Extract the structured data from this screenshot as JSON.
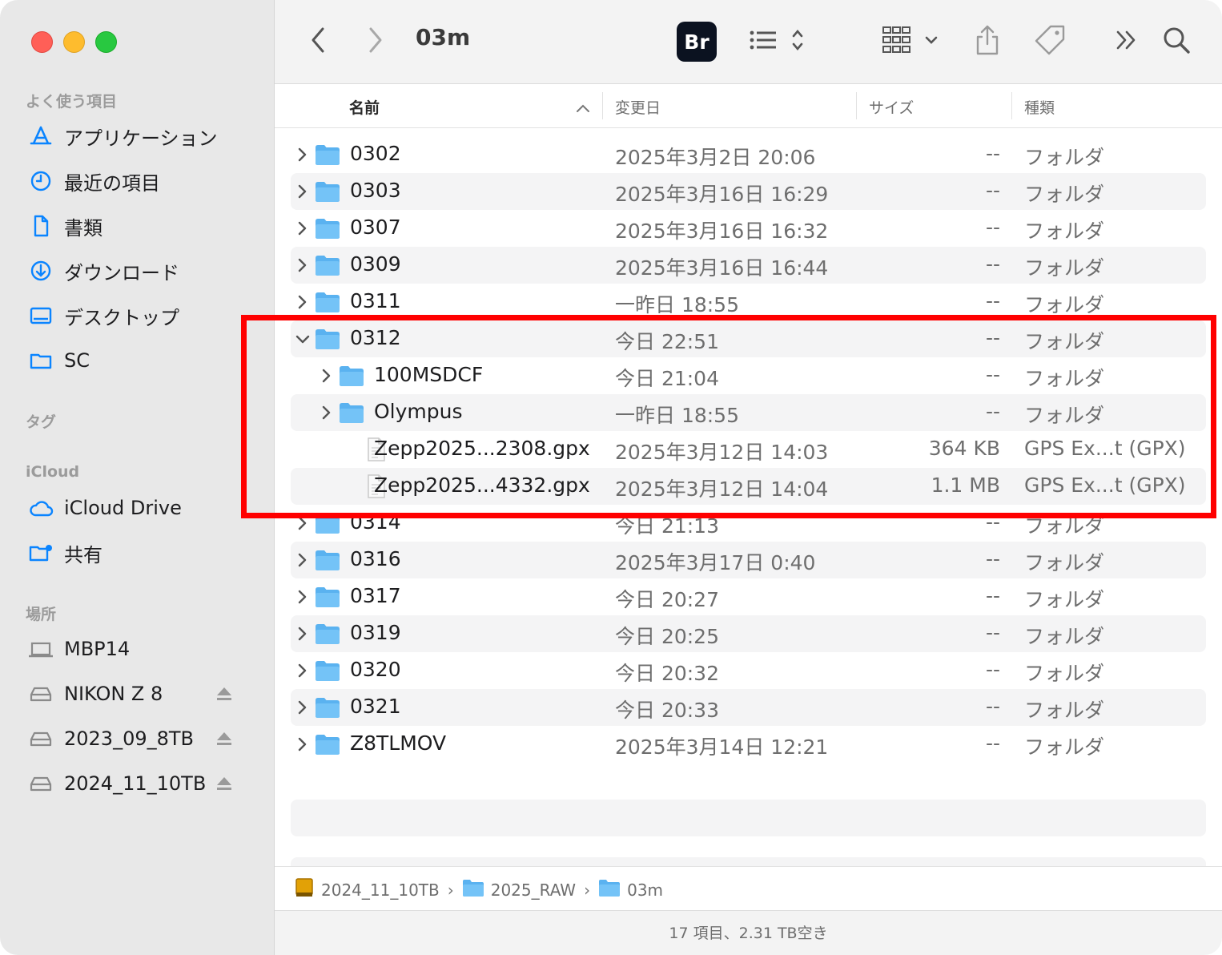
{
  "window": {
    "title": "03m"
  },
  "colors": {
    "accent": "#0a84ff",
    "folder": "#5ab2f0",
    "highlight": "#ff0000"
  },
  "sidebar": {
    "favorites_title": "よく使う項目",
    "favorites": [
      {
        "label": "アプリケーション",
        "icon": "applications-icon"
      },
      {
        "label": "最近の項目",
        "icon": "recents-icon"
      },
      {
        "label": "書類",
        "icon": "document-icon"
      },
      {
        "label": "ダウンロード",
        "icon": "download-icon"
      },
      {
        "label": "デスクトップ",
        "icon": "desktop-icon"
      },
      {
        "label": "SC",
        "icon": "folder-icon"
      }
    ],
    "tags_title": "タグ",
    "icloud_title": "iCloud",
    "icloud": [
      {
        "label": "iCloud Drive",
        "icon": "cloud-icon"
      },
      {
        "label": "共有",
        "icon": "shared-folder-icon"
      }
    ],
    "locations_title": "場所",
    "locations": [
      {
        "label": "MBP14",
        "icon": "laptop-icon"
      },
      {
        "label": "NIKON Z 8",
        "icon": "drive-icon"
      },
      {
        "label": "2023_09_8TB",
        "icon": "drive-icon"
      },
      {
        "label": "2024_11_10TB",
        "icon": "drive-icon"
      }
    ]
  },
  "toolbar": {
    "bridge_label": "Br"
  },
  "columns": {
    "name": "名前",
    "date": "変更日",
    "size": "サイズ",
    "kind": "種類"
  },
  "rows": [
    {
      "name": "0302",
      "date": "2025年3月2日 20:06",
      "size": "--",
      "kind": "フォルダ"
    },
    {
      "name": "0303",
      "date": "2025年3月16日 16:29",
      "size": "--",
      "kind": "フォルダ"
    },
    {
      "name": "0307",
      "date": "2025年3月16日 16:32",
      "size": "--",
      "kind": "フォルダ"
    },
    {
      "name": "0309",
      "date": "2025年3月16日 16:44",
      "size": "--",
      "kind": "フォルダ"
    },
    {
      "name": "0311",
      "date": "一昨日 18:55",
      "size": "--",
      "kind": "フォルダ"
    },
    {
      "name": "0312",
      "date": "今日 22:51",
      "size": "--",
      "kind": "フォルダ"
    },
    {
      "name": "100MSDCF",
      "date": "今日 21:04",
      "size": "--",
      "kind": "フォルダ"
    },
    {
      "name": "Olympus",
      "date": "一昨日 18:55",
      "size": "--",
      "kind": "フォルダ"
    },
    {
      "name": "Zepp2025...2308.gpx",
      "date": "2025年3月12日 14:03",
      "size": "364 KB",
      "kind": "GPS Ex...t (GPX)"
    },
    {
      "name": "Zepp2025...4332.gpx",
      "date": "2025年3月12日 14:04",
      "size": "1.1 MB",
      "kind": "GPS Ex...t (GPX)"
    },
    {
      "name": "0314",
      "date": "今日 21:13",
      "size": "--",
      "kind": "フォルダ"
    },
    {
      "name": "0316",
      "date": "2025年3月17日 0:40",
      "size": "--",
      "kind": "フォルダ"
    },
    {
      "name": "0317",
      "date": "今日 20:27",
      "size": "--",
      "kind": "フォルダ"
    },
    {
      "name": "0319",
      "date": "今日 20:25",
      "size": "--",
      "kind": "フォルダ"
    },
    {
      "name": "0320",
      "date": "今日 20:32",
      "size": "--",
      "kind": "フォルダ"
    },
    {
      "name": "0321",
      "date": "今日 20:33",
      "size": "--",
      "kind": "フォルダ"
    },
    {
      "name": "Z8TLMOV",
      "date": "2025年3月14日 12:21",
      "size": "--",
      "kind": "フォルダ"
    }
  ],
  "pathbar": [
    {
      "label": "2024_11_10TB"
    },
    {
      "label": "2025_RAW"
    },
    {
      "label": "03m"
    }
  ],
  "status": "17 項目、2.31 TB空き"
}
